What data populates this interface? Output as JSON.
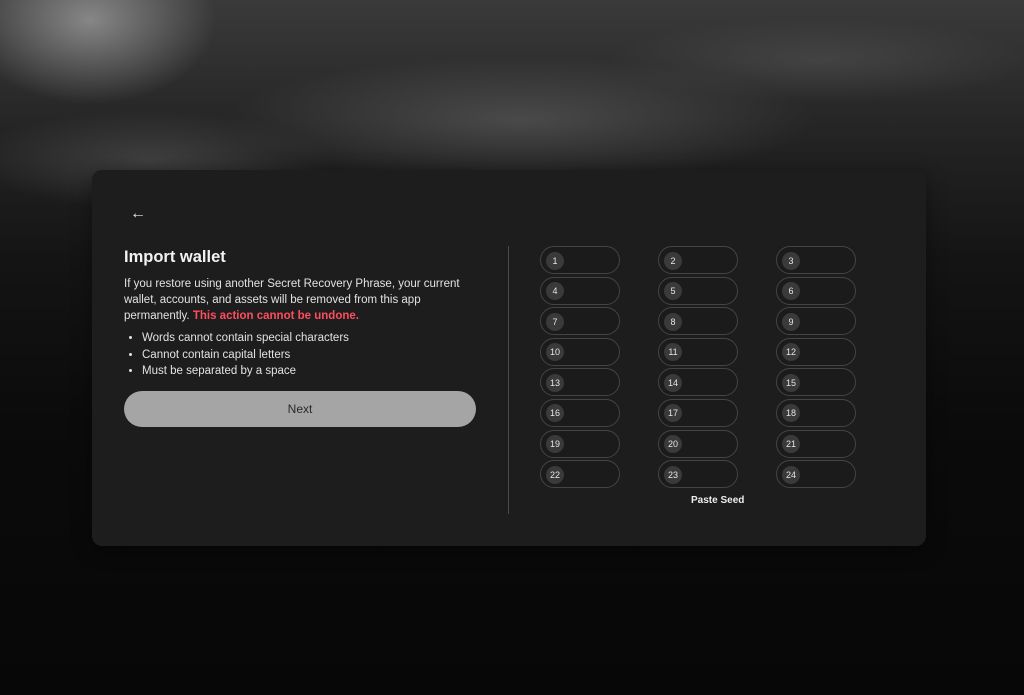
{
  "page": {
    "back_icon": "arrow-left-icon",
    "title": "Import wallet",
    "description": "If you restore using another Secret Recovery Phrase, your current wallet, accounts, and assets will be removed from this app permanently.",
    "warning": "This action cannot be undone.",
    "rules": [
      "Words cannot contain special characters",
      "Cannot contain capital letters",
      "Must be separated by a space"
    ],
    "next_label": "Next",
    "paste_label": "Paste Seed"
  },
  "seed_words": [
    {
      "number": "1",
      "value": ""
    },
    {
      "number": "2",
      "value": ""
    },
    {
      "number": "3",
      "value": ""
    },
    {
      "number": "4",
      "value": ""
    },
    {
      "number": "5",
      "value": ""
    },
    {
      "number": "6",
      "value": ""
    },
    {
      "number": "7",
      "value": ""
    },
    {
      "number": "8",
      "value": ""
    },
    {
      "number": "9",
      "value": ""
    },
    {
      "number": "10",
      "value": ""
    },
    {
      "number": "11",
      "value": ""
    },
    {
      "number": "12",
      "value": ""
    },
    {
      "number": "13",
      "value": ""
    },
    {
      "number": "14",
      "value": ""
    },
    {
      "number": "15",
      "value": ""
    },
    {
      "number": "16",
      "value": ""
    },
    {
      "number": "17",
      "value": ""
    },
    {
      "number": "18",
      "value": ""
    },
    {
      "number": "19",
      "value": ""
    },
    {
      "number": "20",
      "value": ""
    },
    {
      "number": "21",
      "value": ""
    },
    {
      "number": "22",
      "value": ""
    },
    {
      "number": "23",
      "value": ""
    },
    {
      "number": "24",
      "value": ""
    }
  ],
  "colors": {
    "card": "#1d1d1d",
    "warning": "#ff4d5e",
    "next_button": "#a5a5a5"
  }
}
